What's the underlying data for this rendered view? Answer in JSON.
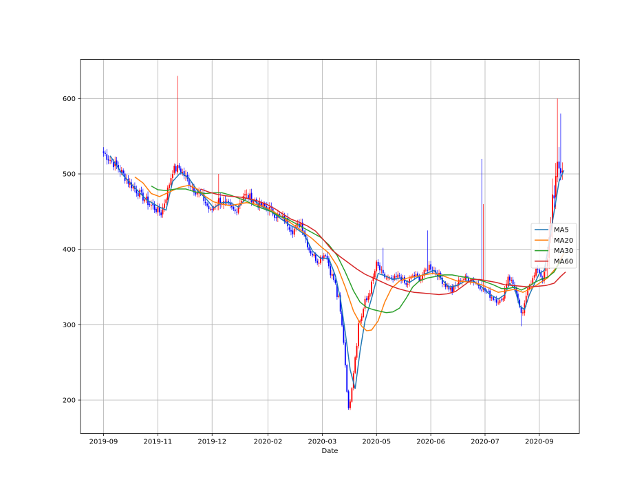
{
  "chart_data": {
    "type": "candlestick",
    "title": "",
    "xlabel": "Date",
    "ylabel": "",
    "ylim": [
      155,
      650
    ],
    "yticks": [
      200,
      300,
      400,
      500,
      600
    ],
    "xticks": [
      "2019-09",
      "2019-11",
      "2019-12",
      "2020-02",
      "2020-03",
      "2020-05",
      "2020-06",
      "2020-07",
      "2020-09"
    ],
    "grid": true,
    "legend_position": "right",
    "up_color": "#ff0000",
    "down_color": "#0000ff",
    "close_anchors": [
      [
        0,
        528
      ],
      [
        10,
        505
      ],
      [
        15,
        490
      ],
      [
        20,
        478
      ],
      [
        28,
        460
      ],
      [
        35,
        448
      ],
      [
        38,
        470
      ],
      [
        42,
        505
      ],
      [
        46,
        508
      ],
      [
        50,
        495
      ],
      [
        55,
        480
      ],
      [
        60,
        470
      ],
      [
        65,
        450
      ],
      [
        70,
        465
      ],
      [
        75,
        458
      ],
      [
        80,
        450
      ],
      [
        85,
        472
      ],
      [
        90,
        468
      ],
      [
        95,
        458
      ],
      [
        100,
        455
      ],
      [
        105,
        445
      ],
      [
        110,
        440
      ],
      [
        115,
        425
      ],
      [
        120,
        435
      ],
      [
        125,
        400
      ],
      [
        130,
        385
      ],
      [
        135,
        395
      ],
      [
        138,
        370
      ],
      [
        140,
        360
      ],
      [
        143,
        330
      ],
      [
        146,
        280
      ],
      [
        149,
        185
      ],
      [
        152,
        240
      ],
      [
        155,
        300
      ],
      [
        158,
        320
      ],
      [
        162,
        345
      ],
      [
        166,
        380
      ],
      [
        170,
        365
      ],
      [
        175,
        358
      ],
      [
        180,
        365
      ],
      [
        184,
        352
      ],
      [
        188,
        365
      ],
      [
        193,
        362
      ],
      [
        198,
        378
      ],
      [
        203,
        368
      ],
      [
        207,
        355
      ],
      [
        212,
        345
      ],
      [
        217,
        360
      ],
      [
        222,
        362
      ],
      [
        227,
        355
      ],
      [
        232,
        345
      ],
      [
        237,
        335
      ],
      [
        242,
        330
      ],
      [
        246,
        365
      ],
      [
        250,
        350
      ],
      [
        253,
        320
      ],
      [
        255,
        313
      ],
      [
        258,
        352
      ],
      [
        261,
        360
      ],
      [
        264,
        375
      ],
      [
        267,
        360
      ],
      [
        270,
        380
      ],
      [
        273,
        470
      ],
      [
        276,
        500
      ],
      [
        279,
        510
      ]
    ],
    "series": [
      {
        "name": "MA5",
        "color": "#1f77b4",
        "points": [
          [
            4,
            524
          ],
          [
            12,
            498
          ],
          [
            18,
            484
          ],
          [
            26,
            466
          ],
          [
            34,
            456
          ],
          [
            38,
            452
          ],
          [
            42,
            490
          ],
          [
            47,
            502
          ],
          [
            52,
            494
          ],
          [
            57,
            478
          ],
          [
            62,
            468
          ],
          [
            67,
            455
          ],
          [
            72,
            462
          ],
          [
            77,
            462
          ],
          [
            82,
            456
          ],
          [
            87,
            468
          ],
          [
            92,
            464
          ],
          [
            97,
            456
          ],
          [
            102,
            450
          ],
          [
            107,
            442
          ],
          [
            112,
            434
          ],
          [
            117,
            428
          ],
          [
            122,
            420
          ],
          [
            127,
            398
          ],
          [
            132,
            388
          ],
          [
            137,
            388
          ],
          [
            141,
            365
          ],
          [
            144,
            335
          ],
          [
            147,
            290
          ],
          [
            150,
            240
          ],
          [
            153,
            215
          ],
          [
            156,
            265
          ],
          [
            159,
            305
          ],
          [
            163,
            335
          ],
          [
            167,
            368
          ],
          [
            171,
            365
          ],
          [
            176,
            360
          ],
          [
            181,
            362
          ],
          [
            186,
            356
          ],
          [
            191,
            363
          ],
          [
            196,
            368
          ],
          [
            201,
            372
          ],
          [
            205,
            362
          ],
          [
            210,
            350
          ],
          [
            215,
            352
          ],
          [
            220,
            358
          ],
          [
            225,
            358
          ],
          [
            230,
            350
          ],
          [
            235,
            340
          ],
          [
            240,
            334
          ],
          [
            244,
            340
          ],
          [
            247,
            355
          ],
          [
            250,
            348
          ],
          [
            253,
            325
          ],
          [
            256,
            320
          ],
          [
            259,
            340
          ],
          [
            262,
            354
          ],
          [
            265,
            368
          ],
          [
            268,
            372
          ],
          [
            271,
            410
          ],
          [
            274,
            450
          ],
          [
            277,
            490
          ],
          [
            280,
            505
          ]
        ]
      },
      {
        "name": "MA20",
        "color": "#ff7f0e",
        "points": [
          [
            19,
            496
          ],
          [
            24,
            488
          ],
          [
            29,
            474
          ],
          [
            34,
            470
          ],
          [
            40,
            476
          ],
          [
            46,
            482
          ],
          [
            52,
            485
          ],
          [
            57,
            480
          ],
          [
            62,
            470
          ],
          [
            67,
            463
          ],
          [
            72,
            460
          ],
          [
            77,
            458
          ],
          [
            82,
            460
          ],
          [
            87,
            462
          ],
          [
            92,
            460
          ],
          [
            97,
            457
          ],
          [
            102,
            452
          ],
          [
            107,
            445
          ],
          [
            112,
            438
          ],
          [
            117,
            430
          ],
          [
            122,
            422
          ],
          [
            127,
            414
          ],
          [
            132,
            404
          ],
          [
            137,
            395
          ],
          [
            142,
            378
          ],
          [
            147,
            350
          ],
          [
            152,
            318
          ],
          [
            157,
            298
          ],
          [
            160,
            292
          ],
          [
            163,
            293
          ],
          [
            167,
            305
          ],
          [
            171,
            330
          ],
          [
            175,
            348
          ],
          [
            180,
            358
          ],
          [
            185,
            362
          ],
          [
            190,
            364
          ],
          [
            195,
            366
          ],
          [
            200,
            368
          ],
          [
            205,
            366
          ],
          [
            210,
            362
          ],
          [
            215,
            358
          ],
          [
            220,
            357
          ],
          [
            225,
            356
          ],
          [
            230,
            353
          ],
          [
            235,
            348
          ],
          [
            240,
            343
          ],
          [
            245,
            345
          ],
          [
            250,
            347
          ],
          [
            255,
            343
          ],
          [
            260,
            348
          ],
          [
            265,
            355
          ],
          [
            270,
            362
          ],
          [
            275,
            375
          ],
          [
            280,
            395
          ]
        ]
      },
      {
        "name": "MA30",
        "color": "#2ca02c",
        "points": [
          [
            29,
            484
          ],
          [
            33,
            479
          ],
          [
            38,
            478
          ],
          [
            44,
            480
          ],
          [
            50,
            480
          ],
          [
            56,
            476
          ],
          [
            62,
            474
          ],
          [
            67,
            475
          ],
          [
            72,
            475
          ],
          [
            77,
            472
          ],
          [
            82,
            468
          ],
          [
            87,
            464
          ],
          [
            92,
            458
          ],
          [
            97,
            454
          ],
          [
            102,
            450
          ],
          [
            107,
            444
          ],
          [
            112,
            440
          ],
          [
            117,
            434
          ],
          [
            122,
            428
          ],
          [
            127,
            422
          ],
          [
            132,
            416
          ],
          [
            137,
            406
          ],
          [
            142,
            392
          ],
          [
            147,
            370
          ],
          [
            152,
            345
          ],
          [
            156,
            330
          ],
          [
            160,
            323
          ],
          [
            164,
            320
          ],
          [
            168,
            318
          ],
          [
            172,
            316
          ],
          [
            176,
            317
          ],
          [
            180,
            322
          ],
          [
            184,
            335
          ],
          [
            188,
            350
          ],
          [
            192,
            358
          ],
          [
            197,
            362
          ],
          [
            202,
            364
          ],
          [
            207,
            366
          ],
          [
            212,
            366
          ],
          [
            217,
            364
          ],
          [
            222,
            362
          ],
          [
            227,
            360
          ],
          [
            232,
            357
          ],
          [
            237,
            353
          ],
          [
            242,
            348
          ],
          [
            246,
            348
          ],
          [
            250,
            350
          ],
          [
            254,
            346
          ],
          [
            258,
            350
          ],
          [
            262,
            356
          ],
          [
            266,
            360
          ],
          [
            270,
            363
          ],
          [
            274,
            370
          ],
          [
            278,
            385
          ]
        ]
      },
      {
        "name": "MA60",
        "color": "#d62728",
        "points": [
          [
            59,
            480
          ],
          [
            64,
            476
          ],
          [
            69,
            473
          ],
          [
            74,
            471
          ],
          [
            79,
            470
          ],
          [
            84,
            469
          ],
          [
            89,
            467
          ],
          [
            94,
            464
          ],
          [
            99,
            460
          ],
          [
            104,
            454
          ],
          [
            109,
            447
          ],
          [
            114,
            440
          ],
          [
            119,
            436
          ],
          [
            124,
            431
          ],
          [
            129,
            424
          ],
          [
            134,
            412
          ],
          [
            139,
            399
          ],
          [
            144,
            390
          ],
          [
            149,
            382
          ],
          [
            154,
            374
          ],
          [
            159,
            367
          ],
          [
            164,
            362
          ],
          [
            169,
            357
          ],
          [
            174,
            352
          ],
          [
            179,
            348
          ],
          [
            184,
            345
          ],
          [
            189,
            343
          ],
          [
            194,
            342
          ],
          [
            199,
            341
          ],
          [
            204,
            340
          ],
          [
            209,
            341
          ],
          [
            214,
            344
          ],
          [
            219,
            352
          ],
          [
            224,
            360
          ],
          [
            229,
            360
          ],
          [
            234,
            358
          ],
          [
            239,
            356
          ],
          [
            244,
            353
          ],
          [
            249,
            352
          ],
          [
            254,
            351
          ],
          [
            259,
            350
          ],
          [
            264,
            351
          ],
          [
            269,
            352
          ],
          [
            274,
            355
          ],
          [
            278,
            364
          ],
          [
            281,
            370
          ]
        ]
      }
    ]
  }
}
